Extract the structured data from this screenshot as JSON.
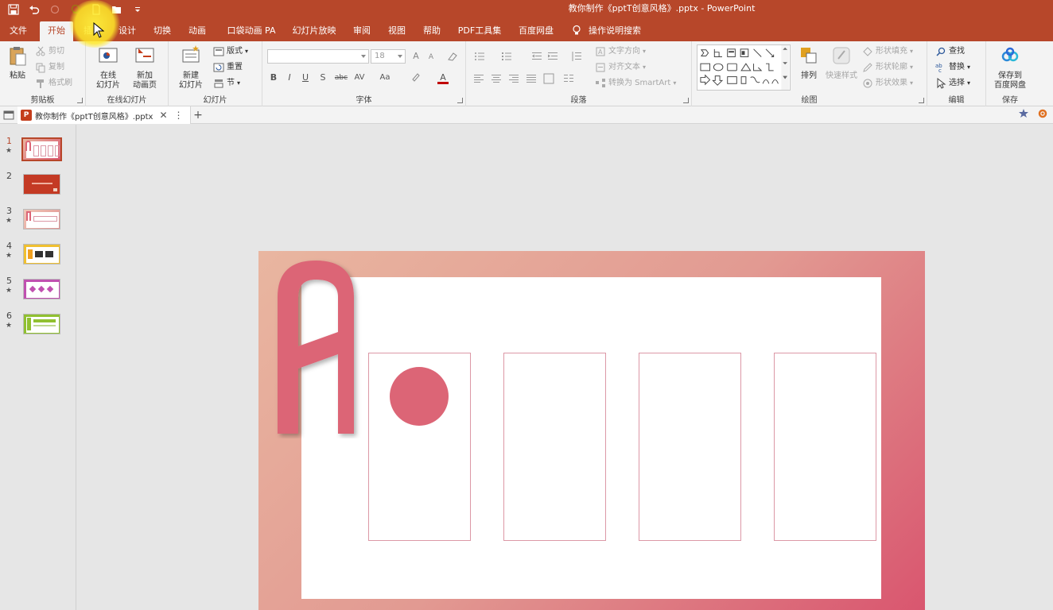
{
  "title_bar": {
    "document_title": "教你制作《pptT创意风格》.pptx  -  PowerPoint",
    "qat_icons": [
      "save-icon",
      "undo-icon",
      "redo-icon",
      "touch-mode-icon",
      "new-file-icon",
      "open-folder-icon",
      "customize-qat-icon"
    ]
  },
  "menu": {
    "tabs": [
      "文件",
      "开始",
      "插入",
      "设计",
      "切换",
      "动画",
      "口袋动画 PA",
      "幻灯片放映",
      "审阅",
      "视图",
      "帮助",
      "PDF工具集",
      "百度网盘"
    ],
    "active_tab": "开始",
    "tell_me": "操作说明搜索"
  },
  "ribbon": {
    "clipboard": {
      "label": "剪贴板",
      "paste": "粘贴",
      "cut": "剪切",
      "copy": "复制",
      "format_painter": "格式刷"
    },
    "online_slides": {
      "label": "在线幻灯片",
      "online_slide": [
        "在线",
        "幻灯片"
      ],
      "new_animation_page": [
        "新加",
        "动画页"
      ]
    },
    "slides": {
      "label": "幻灯片",
      "new_slide": [
        "新建",
        "幻灯片"
      ],
      "layout": "版式",
      "reset": "重置",
      "section": "节"
    },
    "font": {
      "label": "字体",
      "font_name": "",
      "font_size": "18",
      "bold": "B",
      "italic": "I",
      "underline": "U",
      "shadow": "S",
      "strikethrough": "abc",
      "spacing": "AV",
      "case": "Aa",
      "grow": "A",
      "shrink": "A",
      "font_color": "A"
    },
    "paragraph": {
      "label": "段落",
      "text_direction": "文字方向",
      "align_text": "对齐文本",
      "convert_smartart": "转换为 SmartArt"
    },
    "drawing": {
      "label": "绘图",
      "arrange": "排列",
      "quick_styles": "快速样式",
      "shape_fill": "形状填充",
      "shape_outline": "形状轮廓",
      "shape_effects": "形状效果"
    },
    "editing": {
      "label": "编辑",
      "find": "查找",
      "replace": "替换",
      "select": "选择"
    },
    "save": {
      "label": "保存",
      "save_to_baidu": [
        "保存到",
        "百度网盘"
      ]
    }
  },
  "doc_tabs": {
    "file_tab": "教你制作《pptT创意风格》.pptx",
    "close": "✕",
    "more": "⋮",
    "add": "+"
  },
  "thumbnails": [
    {
      "number": "1",
      "star": "★",
      "selected": true
    },
    {
      "number": "2",
      "star": "",
      "selected": false
    },
    {
      "number": "3",
      "star": "★",
      "selected": false
    },
    {
      "number": "4",
      "star": "★",
      "selected": false
    },
    {
      "number": "5",
      "star": "★",
      "selected": false
    },
    {
      "number": "6",
      "star": "★",
      "selected": false
    }
  ],
  "colors": {
    "brand": "#b7472a",
    "slide_pink": "#dc6576",
    "card_border": "#dc98a6"
  }
}
